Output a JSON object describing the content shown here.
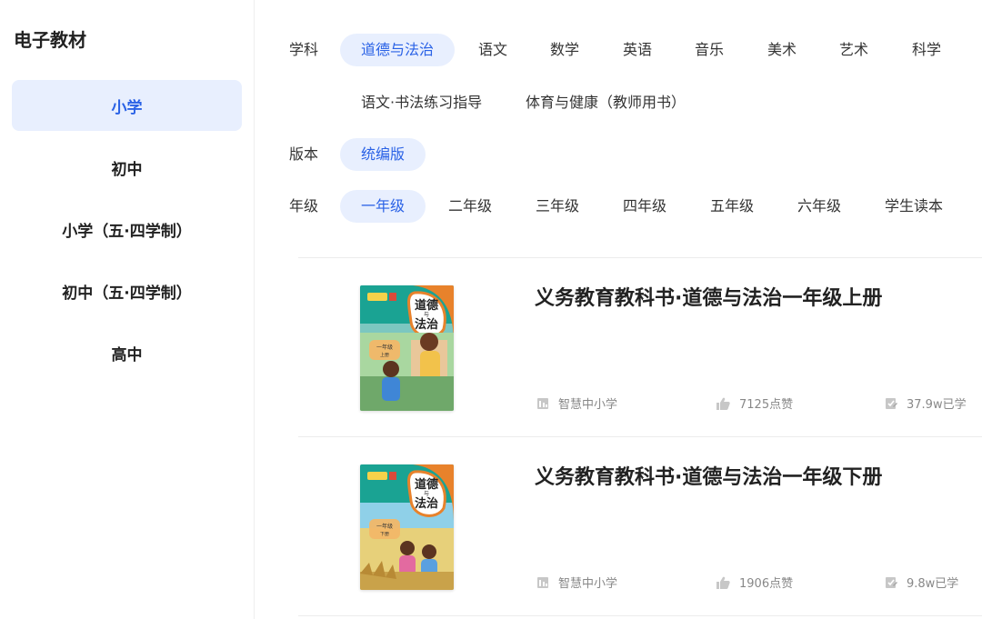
{
  "sidebar": {
    "title": "电子教材",
    "items": [
      {
        "label": "小学",
        "active": true
      },
      {
        "label": "初中",
        "active": false
      },
      {
        "label": "小学（五·四学制）",
        "active": false
      },
      {
        "label": "初中（五·四学制）",
        "active": false
      },
      {
        "label": "高中",
        "active": false
      }
    ]
  },
  "filters": {
    "subject": {
      "label": "学科",
      "options": [
        "道德与法治",
        "语文",
        "数学",
        "英语",
        "音乐",
        "美术",
        "艺术",
        "科学",
        "语文·书法练习指导",
        "体育与健康（教师用书）"
      ],
      "selected": "道德与法治"
    },
    "edition": {
      "label": "版本",
      "options": [
        "统编版"
      ],
      "selected": "统编版"
    },
    "grade": {
      "label": "年级",
      "options": [
        "一年级",
        "二年级",
        "三年级",
        "四年级",
        "五年级",
        "六年级",
        "学生读本"
      ],
      "selected": "一年级"
    }
  },
  "books": [
    {
      "title": "义务教育教科书·道德与法治一年级上册",
      "publisher": "智慧中小学",
      "likes": "7125点赞",
      "learners": "37.9w已学",
      "cover": {
        "title_line1": "道德",
        "title_small": "与",
        "title_line2": "法治",
        "grade": "一年级",
        "volume": "上册"
      }
    },
    {
      "title": "义务教育教科书·道德与法治一年级下册",
      "publisher": "智慧中小学",
      "likes": "1906点赞",
      "learners": "9.8w已学",
      "cover": {
        "title_line1": "道德",
        "title_small": "与",
        "title_line2": "法治",
        "grade": "一年级",
        "volume": "下册"
      }
    }
  ],
  "colors": {
    "accent": "#2a62e6",
    "accent_bg": "#e8effe",
    "cover_teal": "#1aa393",
    "cover_orange": "#e8822b"
  }
}
